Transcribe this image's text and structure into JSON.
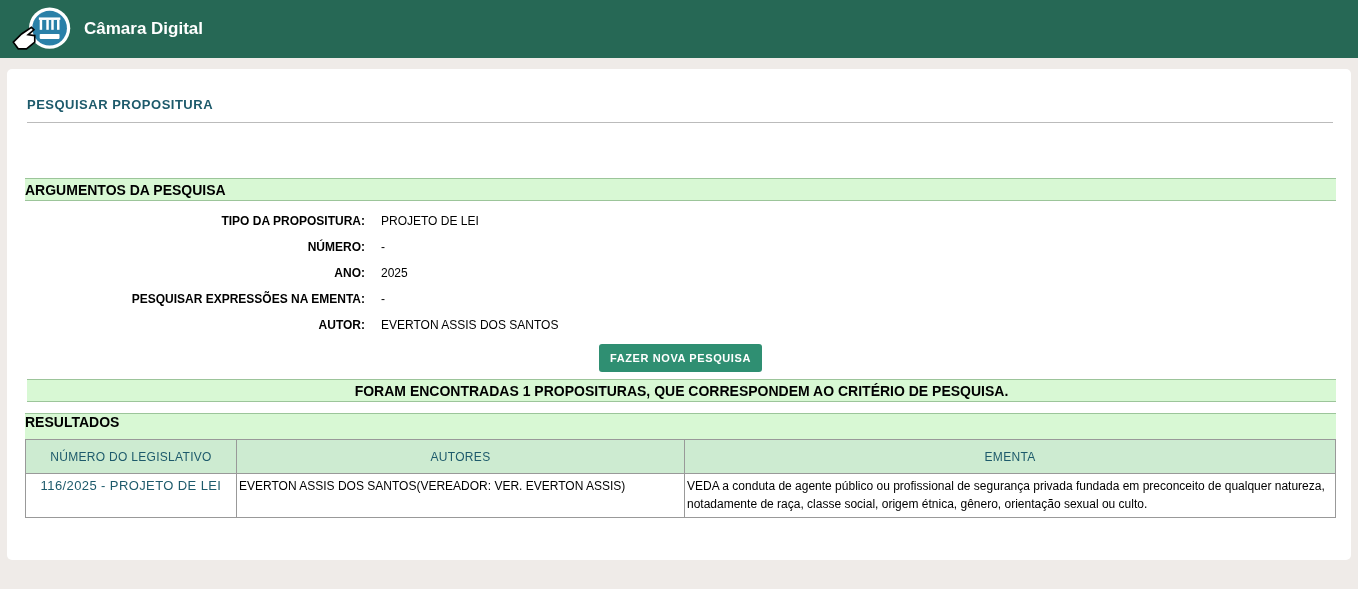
{
  "header": {
    "title": "Câmara Digital"
  },
  "page_title": "PESQUISAR PROPOSITURA",
  "arguments": {
    "heading": "ARGUMENTOS DA PESQUISA",
    "fields": [
      {
        "label": "TIPO DA PROPOSITURA:",
        "value": "PROJETO DE LEI"
      },
      {
        "label": "NÚMERO:",
        "value": "-"
      },
      {
        "label": "ANO:",
        "value": "2025"
      },
      {
        "label": "PESQUISAR EXPRESSÕES NA EMENTA:",
        "value": "-"
      },
      {
        "label": "AUTOR:",
        "value": "EVERTON ASSIS DOS SANTOS"
      }
    ],
    "button": "FAZER NOVA PESQUISA"
  },
  "summary": "FORAM ENCONTRADAS 1 PROPOSITURAS, QUE CORRESPONDEM AO CRITÉRIO DE PESQUISA.",
  "results": {
    "heading": "RESULTADOS",
    "columns": [
      "NÚMERO DO LEGISLATIVO",
      "AUTORES",
      "EMENTA"
    ],
    "rows": [
      {
        "number": "116/2025 - PROJETO DE LEI",
        "authors": "EVERTON ASSIS DOS SANTOS(VEREADOR: VER. EVERTON ASSIS)",
        "ementa": "VEDA a conduta de agente público ou profissional de segurança privada fundada em preconceito de qualquer natureza, notadamente de raça, classe social, origem étnica, gênero, orientação sexual ou culto."
      }
    ]
  }
}
